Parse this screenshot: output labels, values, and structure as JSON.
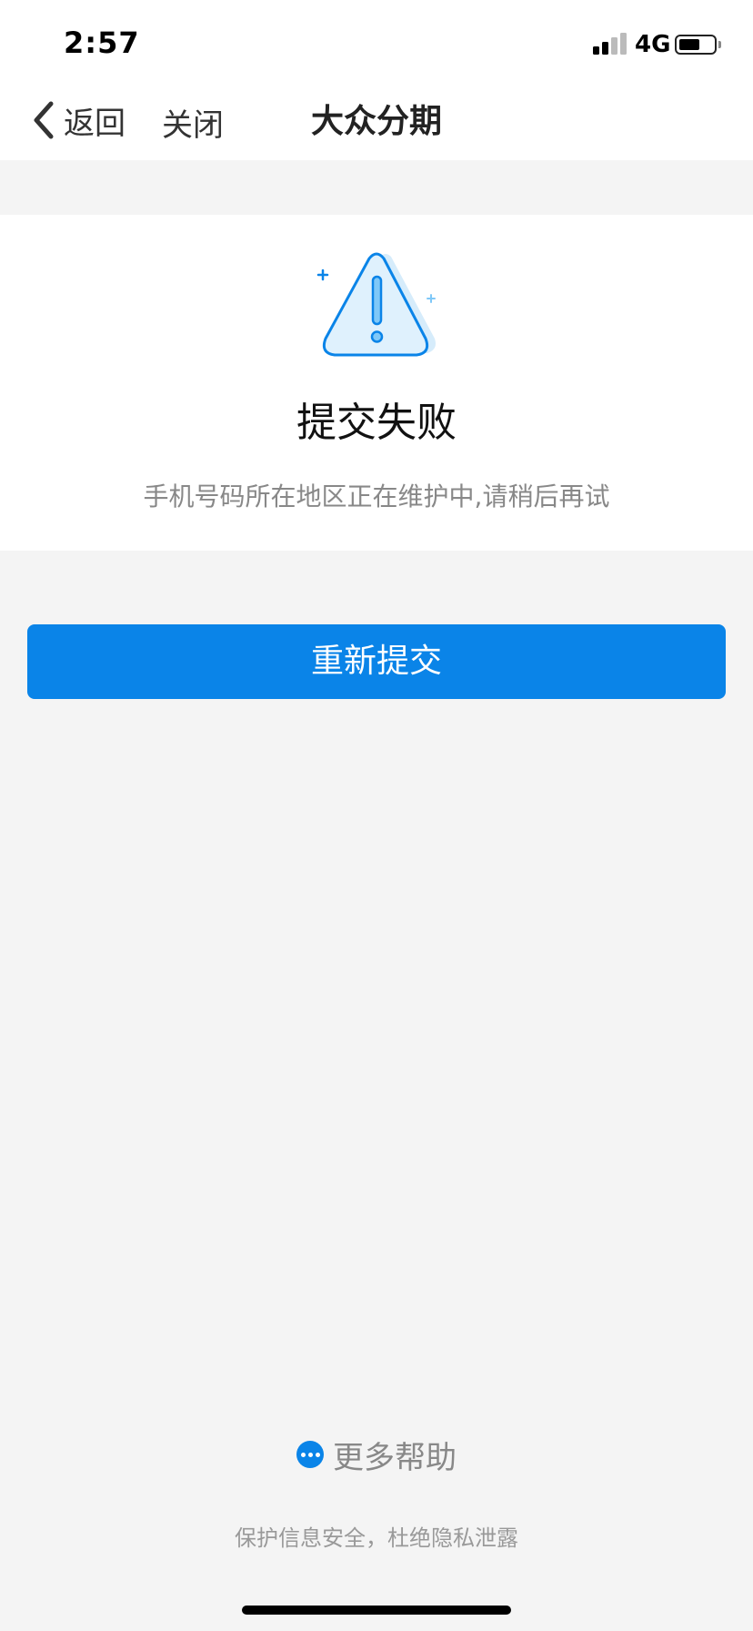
{
  "status_bar": {
    "time": "2:57",
    "network": "4G",
    "signal_level": 0.5,
    "battery_level": 0.6
  },
  "nav": {
    "back_label": "返回",
    "close_label": "关闭",
    "title": "大众分期"
  },
  "result": {
    "icon": "warning-triangle-icon",
    "title": "提交失败",
    "description": "手机号码所在地区正在维护中,请稍后再试"
  },
  "actions": {
    "resubmit_label": "重新提交"
  },
  "help": {
    "icon": "more-dots-icon",
    "label": "更多帮助"
  },
  "footer": {
    "note": "保护信息安全，杜绝隐私泄露"
  },
  "colors": {
    "accent": "#0a84e8",
    "page_background": "#f4f4f4",
    "card_background": "#ffffff"
  }
}
